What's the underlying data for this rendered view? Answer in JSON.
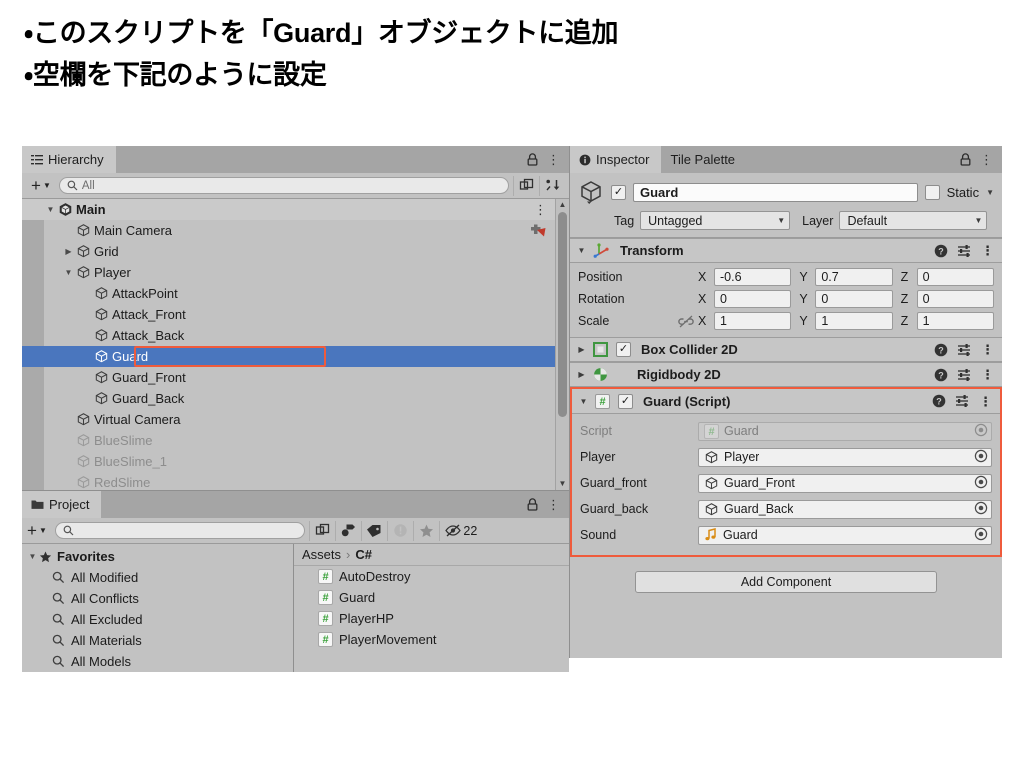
{
  "slide": {
    "lines": [
      "・このスクリプトを「Guard」オブジェクトに追加",
      "・空欄を下記のように設定"
    ]
  },
  "colors": {
    "selection_blue": "#4a76be",
    "highlight_orange": "#ef5b3c",
    "panel_bg": "#c2c2c2",
    "tabstrip_bg": "#a5a5a5",
    "script_icon_green": "#3aa13a"
  },
  "hierarchy": {
    "tab_label": "Hierarchy",
    "tab_icon": "hierarchy-icon",
    "lock_icon": "lock-icon",
    "menu_icon": "kebab-menu-icon",
    "toolbar": {
      "add_label": "+",
      "add_dropdown_icon": "chevron-down-icon",
      "search_icon": "search-icon",
      "search_value": "",
      "search_placeholder": "All",
      "expand_icon": "search-expand-icon",
      "sort_icon": "sort-icon"
    },
    "items": [
      {
        "name": "Main",
        "indent": 0,
        "arrow": "down",
        "icon": "unity-scene-icon",
        "state": "root",
        "trailing_icon": "kebab-menu-icon"
      },
      {
        "name": "Main Camera",
        "indent": 1,
        "arrow": "none",
        "icon": "gameobject-icon",
        "state": "normal",
        "trailing_icon": "prefab-red-icon"
      },
      {
        "name": "Grid",
        "indent": 1,
        "arrow": "right",
        "icon": "gameobject-icon",
        "state": "normal",
        "trailing_icon": ""
      },
      {
        "name": "Player",
        "indent": 1,
        "arrow": "down",
        "icon": "gameobject-icon",
        "state": "normal",
        "trailing_icon": ""
      },
      {
        "name": "AttackPoint",
        "indent": 2,
        "arrow": "none",
        "icon": "gameobject-icon",
        "state": "normal",
        "trailing_icon": ""
      },
      {
        "name": "Attack_Front",
        "indent": 2,
        "arrow": "none",
        "icon": "gameobject-icon",
        "state": "normal",
        "trailing_icon": ""
      },
      {
        "name": "Attack_Back",
        "indent": 2,
        "arrow": "none",
        "icon": "gameobject-icon",
        "state": "normal",
        "trailing_icon": ""
      },
      {
        "name": "Guard",
        "indent": 2,
        "arrow": "none",
        "icon": "gameobject-icon",
        "state": "selected",
        "trailing_icon": ""
      },
      {
        "name": "Guard_Front",
        "indent": 2,
        "arrow": "none",
        "icon": "gameobject-icon",
        "state": "normal",
        "trailing_icon": ""
      },
      {
        "name": "Guard_Back",
        "indent": 2,
        "arrow": "none",
        "icon": "gameobject-icon",
        "state": "normal",
        "trailing_icon": ""
      },
      {
        "name": "Virtual Camera",
        "indent": 1,
        "arrow": "none",
        "icon": "gameobject-icon",
        "state": "normal",
        "trailing_icon": ""
      },
      {
        "name": "BlueSlime",
        "indent": 1,
        "arrow": "none",
        "icon": "gameobject-icon",
        "state": "dim",
        "trailing_icon": ""
      },
      {
        "name": "BlueSlime_1",
        "indent": 1,
        "arrow": "none",
        "icon": "gameobject-icon",
        "state": "dim",
        "trailing_icon": ""
      },
      {
        "name": "RedSlime",
        "indent": 1,
        "arrow": "none",
        "icon": "gameobject-icon",
        "state": "dim",
        "trailing_icon": ""
      }
    ]
  },
  "project": {
    "tab_label": "Project",
    "tab_icon": "folder-icon",
    "lock_icon": "lock-icon",
    "menu_icon": "kebab-menu-icon",
    "toolbar": {
      "add_label": "+",
      "add_dropdown_icon": "chevron-down-icon",
      "search_icon": "search-icon",
      "search_value": "",
      "search_placeholder": "",
      "expand_icon": "search-expand-icon",
      "filter_type_icon": "filter-by-type-icon",
      "filter_label_icon": "filter-by-label-icon",
      "warning_icon": "warning-icon",
      "favorite_icon": "star-icon",
      "hidden_icon": "eye-off-icon",
      "hidden_count": "22"
    },
    "favorites": {
      "header": "Favorites",
      "header_icon": "star-icon",
      "items": [
        {
          "label": "All Modified",
          "icon": "search-icon"
        },
        {
          "label": "All Conflicts",
          "icon": "search-icon"
        },
        {
          "label": "All Excluded",
          "icon": "search-icon"
        },
        {
          "label": "All Materials",
          "icon": "search-icon"
        },
        {
          "label": "All Models",
          "icon": "search-icon"
        }
      ]
    },
    "breadcrumb": {
      "root": "Assets",
      "separator": "›",
      "current": "C#"
    },
    "assets": [
      {
        "name": "AutoDestroy",
        "icon": "csharp-script-icon"
      },
      {
        "name": "Guard",
        "icon": "csharp-script-icon"
      },
      {
        "name": "PlayerHP",
        "icon": "csharp-script-icon"
      },
      {
        "name": "PlayerMovement",
        "icon": "csharp-script-icon"
      }
    ]
  },
  "inspector": {
    "tabs": [
      {
        "label": "Inspector",
        "icon": "info-icon",
        "active": true
      },
      {
        "label": "Tile Palette",
        "icon": "",
        "active": false
      }
    ],
    "lock_icon": "lock-icon",
    "menu_icon": "kebab-menu-icon",
    "header": {
      "object_icon": "gameobject-icon",
      "enabled_checkbox": true,
      "checkmark": "✓",
      "name": "Guard",
      "static_label": "Static",
      "static_checked": false,
      "static_dropdown_icon": "chevron-down-icon",
      "tag_label": "Tag",
      "tag_value": "Untagged",
      "layer_label": "Layer",
      "layer_value": "Default"
    },
    "components": [
      {
        "title": "Transform",
        "icon": "transform-icon",
        "expanded": true,
        "has_checkbox": false,
        "help_icon": "help-icon",
        "preset_icon": "preset-icon",
        "menu_icon": "kebab-menu-icon"
      },
      {
        "title": "Box Collider 2D",
        "icon": "box-collider-2d-icon",
        "expanded": false,
        "has_checkbox": true,
        "checked": true,
        "help_icon": "help-icon",
        "preset_icon": "preset-icon",
        "menu_icon": "kebab-menu-icon"
      },
      {
        "title": "Rigidbody 2D",
        "icon": "rigidbody-2d-icon",
        "expanded": false,
        "has_checkbox": false,
        "help_icon": "help-icon",
        "preset_icon": "preset-icon",
        "menu_icon": "kebab-menu-icon"
      },
      {
        "title": "Guard (Script)",
        "icon": "csharp-script-icon",
        "expanded": true,
        "has_checkbox": true,
        "checked": true,
        "help_icon": "help-icon",
        "preset_icon": "preset-icon",
        "menu_icon": "kebab-menu-icon"
      }
    ],
    "transform": {
      "link_icon": "constrain-proportions-off-icon",
      "rows": [
        {
          "label": "Position",
          "x": "-0.6",
          "y": "0.7",
          "z": "0"
        },
        {
          "label": "Rotation",
          "x": "0",
          "y": "0",
          "z": "0"
        },
        {
          "label": "Scale",
          "x": "1",
          "y": "1",
          "z": "1"
        }
      ],
      "axis_labels": [
        "X",
        "Y",
        "Z"
      ]
    },
    "guard_script": {
      "fields": [
        {
          "label": "Script",
          "value": "Guard",
          "icon": "csharp-script-icon",
          "disabled": true,
          "picker_icon": "object-picker-icon"
        },
        {
          "label": "Player",
          "value": "Player",
          "icon": "gameobject-icon",
          "disabled": false,
          "picker_icon": "object-picker-icon"
        },
        {
          "label": "Guard_front",
          "value": "Guard_Front",
          "icon": "gameobject-icon",
          "disabled": false,
          "picker_icon": "object-picker-icon"
        },
        {
          "label": "Guard_back",
          "value": "Guard_Back",
          "icon": "gameobject-icon",
          "disabled": false,
          "picker_icon": "object-picker-icon"
        },
        {
          "label": "Sound",
          "value": "Guard",
          "icon": "audioclip-icon",
          "disabled": false,
          "picker_icon": "object-picker-icon"
        }
      ]
    },
    "add_component_label": "Add Component"
  }
}
